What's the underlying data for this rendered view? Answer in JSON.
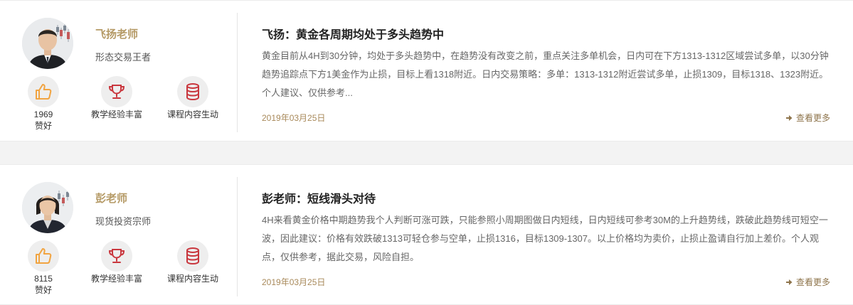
{
  "colors": {
    "accent_gold": "#b59a66",
    "icon_red": "#c9373e",
    "icon_orange": "#f1a441",
    "page_bg": "#f3f3f3"
  },
  "posts": [
    {
      "teacher": {
        "name": "飞扬老师",
        "title": "形态交易王者",
        "likes_count": "1969",
        "likes_label": "赞好",
        "badge_experience": "教学经验丰富",
        "badge_content": "课程内容生动"
      },
      "title": "飞扬：黄金各周期均处于多头趋势中",
      "body": "黄金目前从4H到30分钟，均处于多头趋势中，在趋势没有改变之前，重点关注多单机会，日内可在下方1313-1312区域尝试多单，以30分钟趋势追踪点下方1美金作为止损，目标上看1318附近。日内交易策略：多单：1313-1312附近尝试多单，止损1309，目标1318、1323附近。个人建议、仅供参考...",
      "date": "2019年03月25日",
      "more_label": "查看更多"
    },
    {
      "teacher": {
        "name": "彭老师",
        "title": "现货投资宗师",
        "likes_count": "8115",
        "likes_label": "赞好",
        "badge_experience": "教学经验丰富",
        "badge_content": "课程内容生动"
      },
      "title": "彭老师：短线滑头对待",
      "body": "4H来看黄金价格中期趋势我个人判断可涨可跌，只能参照小周期图做日内短线，日内短线可参考30M的上升趋势线，跌破此趋势线可短空一波，因此建议：价格有效跌破1313可轻仓参与空单，止损1316，目标1309-1307。以上价格均为卖价，止损止盈请自行加上差价。个人观点，仅供参考，据此交易，风险自担。",
      "date": "2019年03月25日",
      "more_label": "查看更多"
    }
  ]
}
